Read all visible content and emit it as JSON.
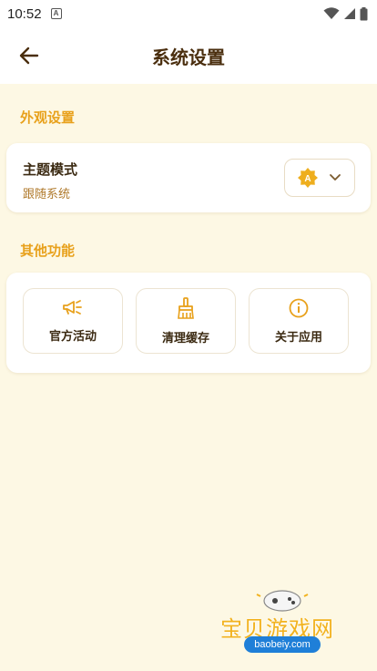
{
  "status_bar": {
    "time": "10:52",
    "notification_icon": "A"
  },
  "app_bar": {
    "title": "系统设置",
    "back_icon": "arrow-left-icon"
  },
  "appearance": {
    "section_title": "外观设置",
    "theme": {
      "title": "主题模式",
      "value": "跟随系统",
      "icon": "auto-theme-icon"
    }
  },
  "functions": {
    "section_title": "其他功能",
    "items": [
      {
        "label": "官方活动",
        "icon": "megaphone-icon"
      },
      {
        "label": "清理缓存",
        "icon": "broom-icon"
      },
      {
        "label": "关于应用",
        "icon": "info-icon"
      }
    ]
  },
  "watermark": {
    "text": "宝贝游戏网",
    "url": "baobeiy.com"
  },
  "colors": {
    "accent": "#e8a11c",
    "background": "#fdf8e4",
    "title": "#4a2e0e"
  }
}
